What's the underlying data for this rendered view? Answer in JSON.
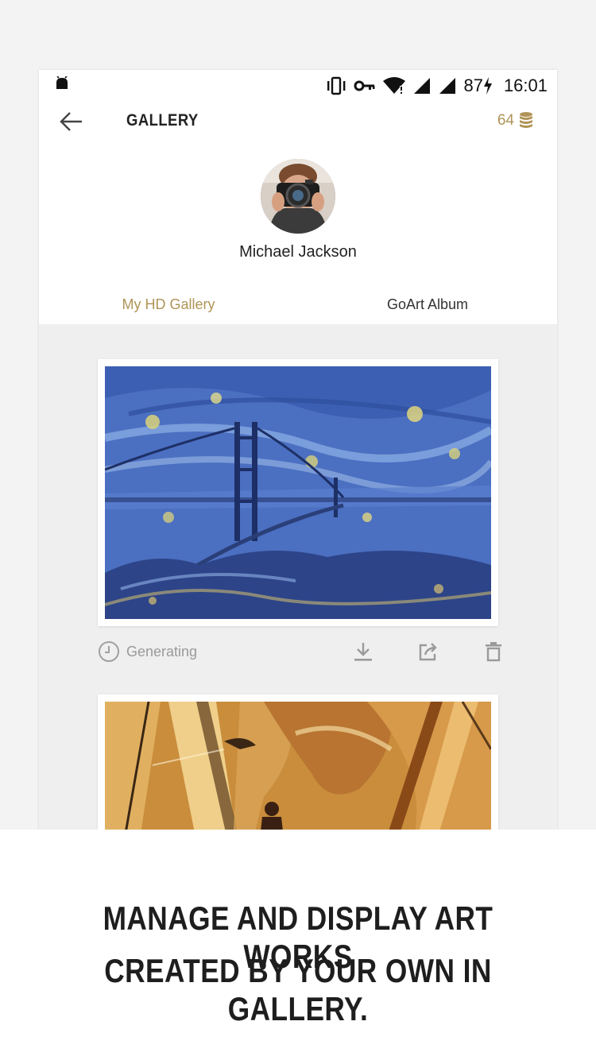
{
  "status_bar": {
    "battery": "87",
    "time": "16:01"
  },
  "app_bar": {
    "title": "GALLERY",
    "coins": "64"
  },
  "profile": {
    "name": "Michael Jackson"
  },
  "tabs": [
    {
      "label": "My HD Gallery",
      "active": true
    },
    {
      "label": "GoArt Album",
      "active": false
    }
  ],
  "gallery": {
    "items": [
      {
        "status": "Generating",
        "art": "starry-night-bridge"
      },
      {
        "art": "orange-sketch-figure"
      }
    ]
  },
  "caption": {
    "line1": "MANAGE AND DISPLAY ART WORKS",
    "line2": "CREATED BY YOUR OWN IN GALLERY."
  },
  "colors": {
    "accent": "#b09457",
    "background": "#efefef"
  }
}
